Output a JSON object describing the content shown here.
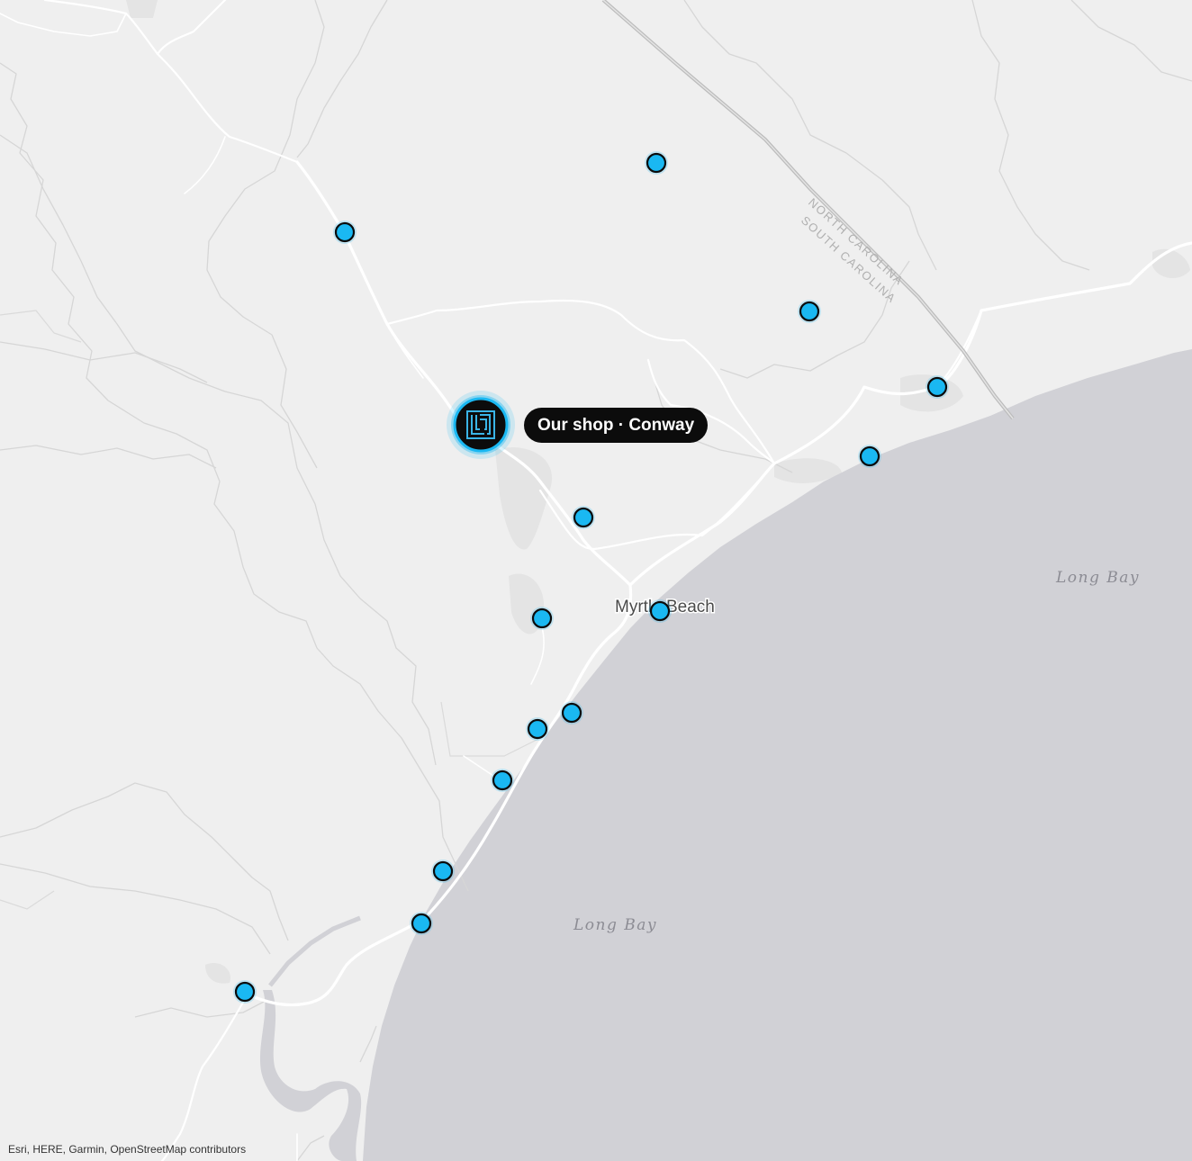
{
  "map": {
    "place_labels": {
      "myrtle_beach": "Myrtle Beach",
      "long_bay_east": "Long Bay",
      "long_bay_south": "Long Bay"
    },
    "state_border_labels": {
      "north": "NORTH CAROLINA",
      "south": "SOUTH CAROLINA"
    },
    "colors": {
      "land": "#efefef",
      "water": "#d1d1d6",
      "roads": "#ffffff",
      "marker_fill": "#1ab8f2",
      "marker_outline": "#0b0b0b",
      "shop_badge": "#0c0c0c"
    },
    "location_markers_count": 14
  },
  "shop_marker": {
    "label": "Our shop · Conway",
    "icon": "shop-logo-icon"
  },
  "attribution": "Esri, HERE, Garmin, OpenStreetMap contributors"
}
